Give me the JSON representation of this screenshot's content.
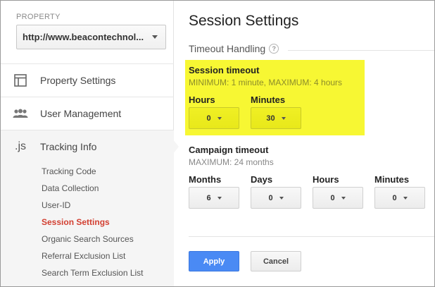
{
  "sidebar": {
    "property_label": "PROPERTY",
    "property_value": "http://www.beacontechnol...",
    "items": [
      {
        "label": "Property Settings",
        "icon": "layout-icon"
      },
      {
        "label": "User Management",
        "icon": "users-icon"
      },
      {
        "label": "Tracking Info",
        "icon_text": ".js"
      }
    ],
    "sub_items": [
      {
        "label": "Tracking Code"
      },
      {
        "label": "Data Collection"
      },
      {
        "label": "User-ID"
      },
      {
        "label": "Session Settings",
        "active": true
      },
      {
        "label": "Organic Search Sources"
      },
      {
        "label": "Referral Exclusion List"
      },
      {
        "label": "Search Term Exclusion List"
      }
    ]
  },
  "main": {
    "title": "Session Settings",
    "section_title": "Timeout Handling",
    "help_glyph": "?",
    "session_timeout": {
      "title": "Session timeout",
      "range": "MINIMUM: 1 minute, MAXIMUM: 4 hours",
      "hours_label": "Hours",
      "hours_value": "0",
      "minutes_label": "Minutes",
      "minutes_value": "30"
    },
    "campaign_timeout": {
      "title": "Campaign timeout",
      "range": "MAXIMUM: 24 months",
      "months_label": "Months",
      "months_value": "6",
      "days_label": "Days",
      "days_value": "0",
      "hours_label": "Hours",
      "hours_value": "0",
      "minutes_label": "Minutes",
      "minutes_value": "0"
    },
    "apply_label": "Apply",
    "cancel_label": "Cancel"
  },
  "colors": {
    "highlight": "#f7f733",
    "active_nav": "#d23f31",
    "primary_button": "#4a8af4"
  }
}
